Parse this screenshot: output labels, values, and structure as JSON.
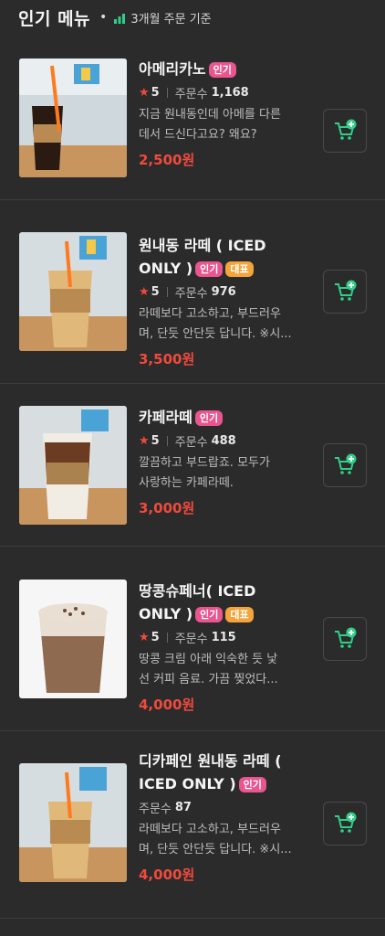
{
  "header": {
    "title": "인기 메뉴",
    "dot": "•",
    "subtitle": "3개월 주문 기준",
    "chart_icon": "bar-chart-icon"
  },
  "orders_label": "주문수",
  "star": "★",
  "colors": {
    "accent_red": "#f04a3c",
    "popular_badge": "#e8558f",
    "rep_badge": "#f3a43a",
    "cart_green": "#2fcf8a"
  },
  "items": [
    {
      "name": "아메리카노",
      "badges": [
        "인기"
      ],
      "rating": "5",
      "orders": "1,168",
      "desc1": "지금 원내동인데 아메를 다른",
      "desc2": "데서 드신다고요? 왜요?",
      "price": "2,500원",
      "photo": "iced-americano-photo"
    },
    {
      "name1": "원내동 라떼 ( ICED",
      "name2": "ONLY )",
      "badges": [
        "인기",
        "대표"
      ],
      "rating": "5",
      "orders": "976",
      "desc1": "라떼보다 고소하고, 부드러우",
      "desc2": "며, 단듯 안단듯 답니다. ※시...",
      "price": "3,500원",
      "photo": "iced-latte-photo"
    },
    {
      "name": "카페라떼",
      "badges": [
        "인기"
      ],
      "rating": "5",
      "orders": "488",
      "desc1": "깔끔하고 부드랍죠. 모두가",
      "desc2": "사랑하는 카페라떼.",
      "price": "3,000원",
      "photo": "cafe-latte-photo"
    },
    {
      "name1": "땅콩슈페너( ICED",
      "name2": "ONLY )",
      "badges": [
        "인기",
        "대표"
      ],
      "rating": "5",
      "orders": "115",
      "desc1": "땅콩 크림 아래 익숙한 듯 낯",
      "desc2": "선 커피 음료. 가끔 찢었다...",
      "price": "4,000원",
      "photo": "peanut-einspanner-photo"
    },
    {
      "name1": "디카페인 원내동 라떼 (",
      "name2": "ICED ONLY )",
      "badges": [
        "인기"
      ],
      "orders": "87",
      "desc1": "라떼보다 고소하고, 부드러우",
      "desc2": "며, 단듯 안단듯 답니다. ※시...",
      "price": "4,000원",
      "photo": "decaf-latte-photo"
    }
  ]
}
